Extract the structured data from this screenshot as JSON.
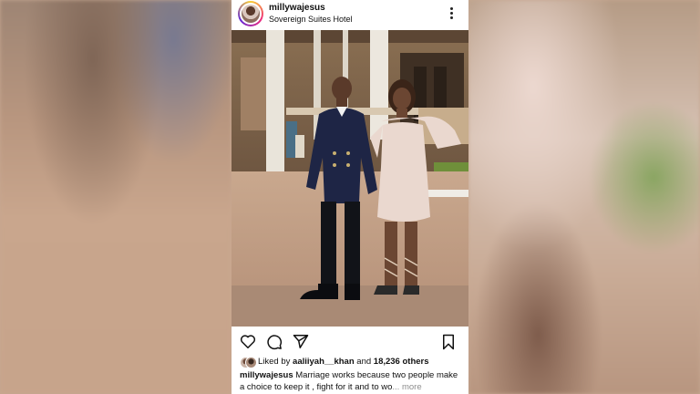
{
  "post": {
    "username": "millywajesus",
    "location": "Sovereign Suites Hotel",
    "likes": {
      "prefix": "Liked by",
      "user": "aaliiyah__khan",
      "joiner": "and",
      "others": "18,236 others"
    },
    "caption": {
      "username": "millywajesus",
      "text": "Marriage works because two people make a choice to keep it , fight for it and to wo",
      "ellipsis": "...",
      "more": "more"
    }
  },
  "icons": {
    "menu": "more-vertical-icon",
    "like": "heart-icon",
    "comment": "comment-icon",
    "share": "send-icon",
    "save": "bookmark-icon"
  },
  "colors": {
    "text": "#111111",
    "muted": "#8e8e8e",
    "blazer": "#1e2545",
    "dress": "#ead8cf"
  }
}
